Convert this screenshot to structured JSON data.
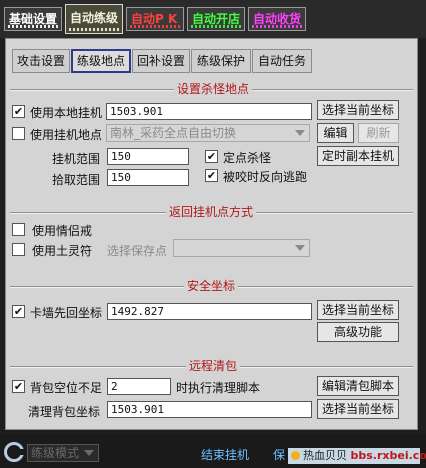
{
  "top_tabs": [
    {
      "label": "基础设置",
      "color": "#ffffff",
      "active": false
    },
    {
      "label": "自动练级",
      "color": "#f4f4dc",
      "active": true
    },
    {
      "label": "自动P K",
      "color": "#ff4040",
      "active": false
    },
    {
      "label": "自动开店",
      "color": "#40ff40",
      "active": false
    },
    {
      "label": "自动收货",
      "color": "#ff40ff",
      "active": false
    }
  ],
  "sub_tabs": [
    "攻击设置",
    "练级地点",
    "回补设置",
    "练级保护",
    "自动任务"
  ],
  "active_sub_tab": "练级地点",
  "section_kill_spot": {
    "title": "设置杀怪地点",
    "use_local_spot": {
      "label": "使用本地挂机",
      "checked": true,
      "value": "1503.901"
    },
    "select_coord_button": "选择当前坐标",
    "use_hang_spot": {
      "label": "使用挂机地点",
      "checked": false,
      "value": "南林_采药全点自由切换"
    },
    "edit_button": "编辑",
    "refresh_button": "刷新",
    "hang_range": {
      "label": "挂机范围",
      "value": "150"
    },
    "pick_range": {
      "label": "拾取范围",
      "value": "150"
    },
    "fixed_kill": {
      "label": "定点杀怪",
      "checked": true
    },
    "reverse_escape": {
      "label": "被咬时反向逃跑",
      "checked": true
    },
    "timed_dungeon_button": "定时副本挂机"
  },
  "section_return": {
    "title": "返回挂机点方式",
    "use_couple_ring": {
      "label": "使用情侣戒",
      "checked": false
    },
    "use_earth_talisman": {
      "label": "使用土灵符",
      "checked": false
    },
    "save_point_label": "选择保存点"
  },
  "section_safe": {
    "title": "安全坐标",
    "wall_return": {
      "label": "卡墙先回坐标",
      "checked": true,
      "value": "1492.827"
    },
    "select_coord_button": "选择当前坐标",
    "advanced_button": "高级功能"
  },
  "section_clear": {
    "title": "远程清包",
    "bag_slots": {
      "label": "背包空位不足",
      "checked": true,
      "value": "2"
    },
    "run_script_label": "时执行清理脚本",
    "edit_script_button": "编辑清包脚本",
    "clear_coord": {
      "label": "清理背包坐标",
      "value": "1503.901"
    },
    "select_coord_button": "选择当前坐标"
  },
  "bottom": {
    "mode_select": "练级模式",
    "end_hang": "结束挂机",
    "save_partial": "保",
    "watermark_prefix": "热血贝贝",
    "watermark_site": "bbs.rxbei.com",
    "logo_color": "#b8c8e8"
  }
}
